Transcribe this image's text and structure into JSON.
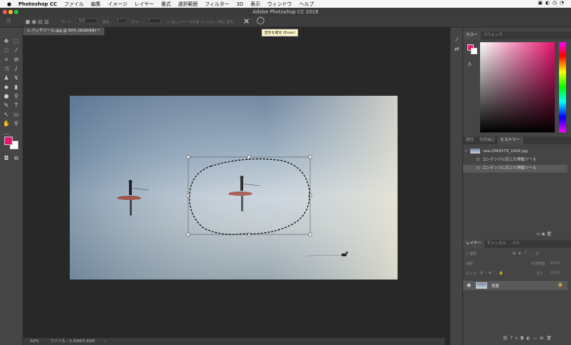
{
  "menubar": {
    "apple": "",
    "app": "Photoshop CC",
    "items": [
      "ファイル",
      "編集",
      "イメージ",
      "レイヤー",
      "書式",
      "選択範囲",
      "フィルター",
      "3D",
      "表示",
      "ウィンドウ",
      "ヘルプ"
    ]
  },
  "window_title": "Adobe Photoshop CC 2018",
  "options": {
    "mode_label": "モード :",
    "mode_value": "移動",
    "struct_label": "構造 :",
    "struct_value": "4",
    "color_label": "カラー :",
    "color_value": "0",
    "sample_all": "全レイヤーを対象",
    "transform_on_drop": "ドロップ時に変形"
  },
  "tooltip": "変形を確定 (Enter)",
  "document": {
    "tab_title": "パッチツール.jpg @ 50% (RGB/8#) *",
    "zoom": "50%",
    "file_info": "ファイル : 5.93M/5.93M"
  },
  "colors": {
    "foreground": "#e8146f",
    "background": "#ffffff",
    "panel_bg": "#454545",
    "canvas_bg": "#282828"
  },
  "color_panel": {
    "tabs": [
      "カラー",
      "スウォッチ"
    ],
    "active_tab": "カラー"
  },
  "history_panel": {
    "tabs": [
      "属性",
      "色調補正",
      "ヒストリー"
    ],
    "active_tab": "ヒストリー",
    "snapshot_name": "sea-2565573_1920.jpg",
    "states": [
      "コンテンツに応じた移動ツール",
      "コンテンツに応じた移動ツール"
    ]
  },
  "layers_panel": {
    "tabs": [
      "レイヤー",
      "チャンネル",
      "パス"
    ],
    "active_tab": "レイヤー",
    "filter_placeholder": "種類",
    "blend_mode": "通常",
    "opacity_label": "不透明度 :",
    "opacity_value": "100%",
    "lock_label": "ロック :",
    "fill_label": "塗り :",
    "fill_value": "100%",
    "layer_name": "背景"
  }
}
